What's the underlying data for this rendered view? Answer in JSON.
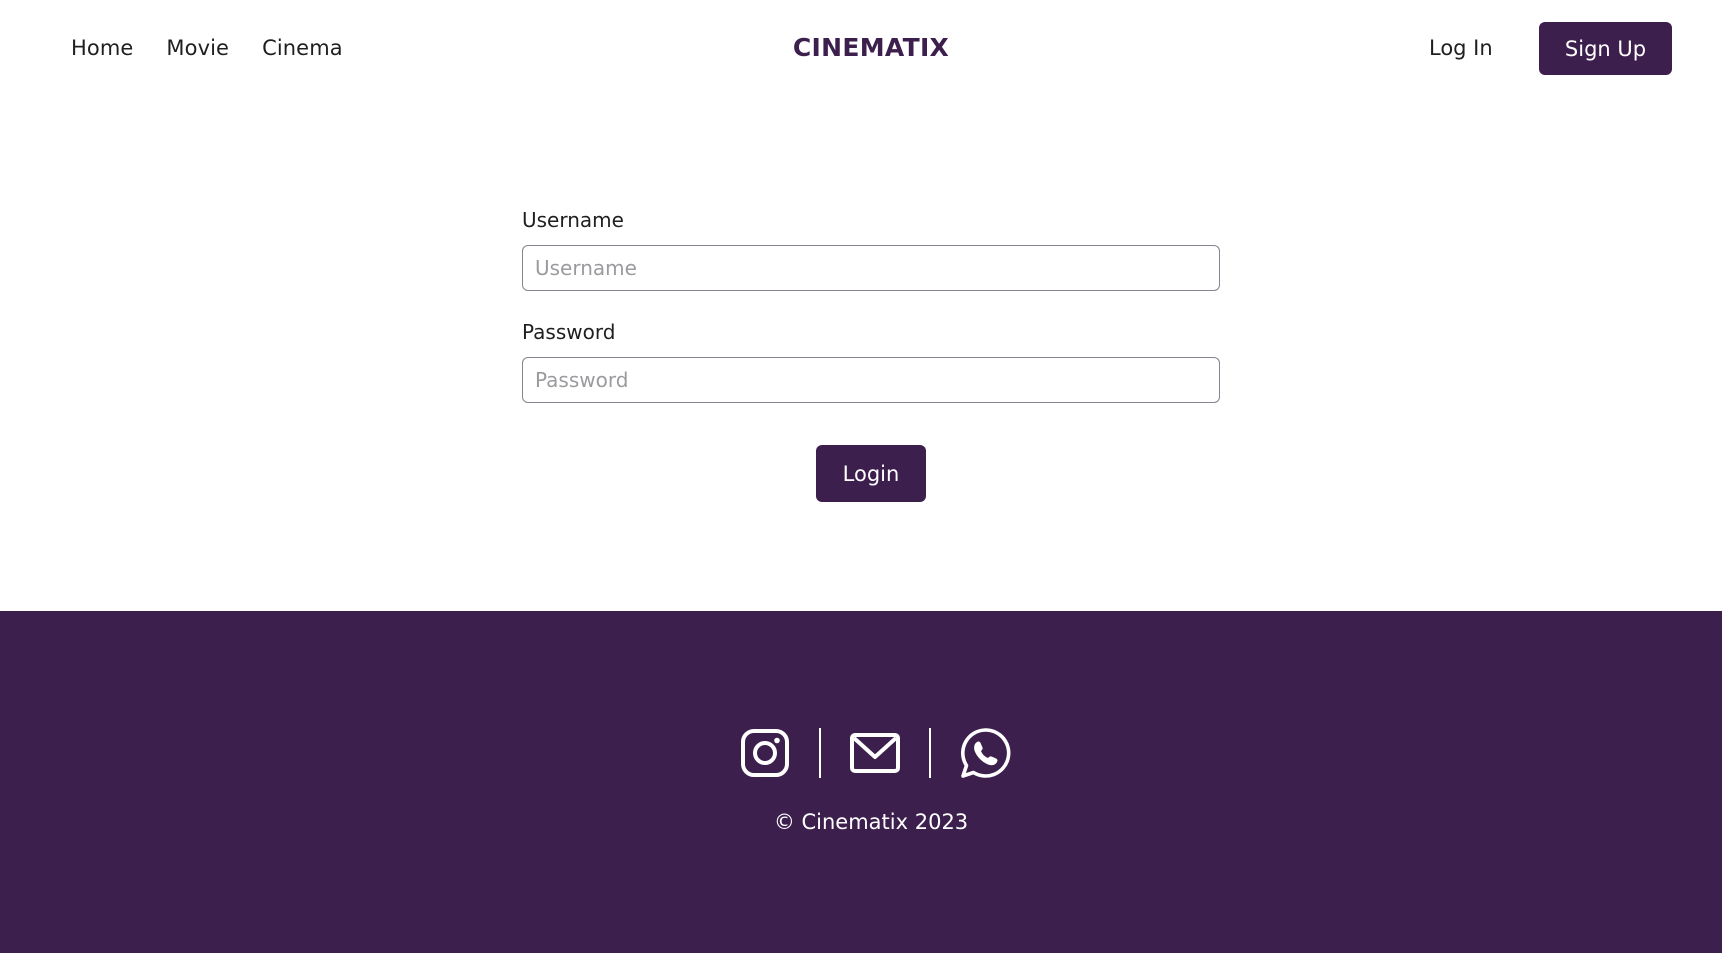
{
  "header": {
    "nav": [
      "Home",
      "Movie",
      "Cinema"
    ],
    "brand": "CINEMATIX",
    "login_label": "Log In",
    "signup_label": "Sign Up"
  },
  "form": {
    "username_label": "Username",
    "username_placeholder": "Username",
    "username_value": "",
    "password_label": "Password",
    "password_placeholder": "Password",
    "password_value": "",
    "submit_label": "Login"
  },
  "footer": {
    "socials": [
      "instagram-icon",
      "mail-icon",
      "whatsapp-icon"
    ],
    "copyright": "© Cinematix 2023"
  },
  "colors": {
    "brand": "#3c1f4d",
    "text": "#1f1f1f",
    "footer_text": "#ffffff"
  }
}
